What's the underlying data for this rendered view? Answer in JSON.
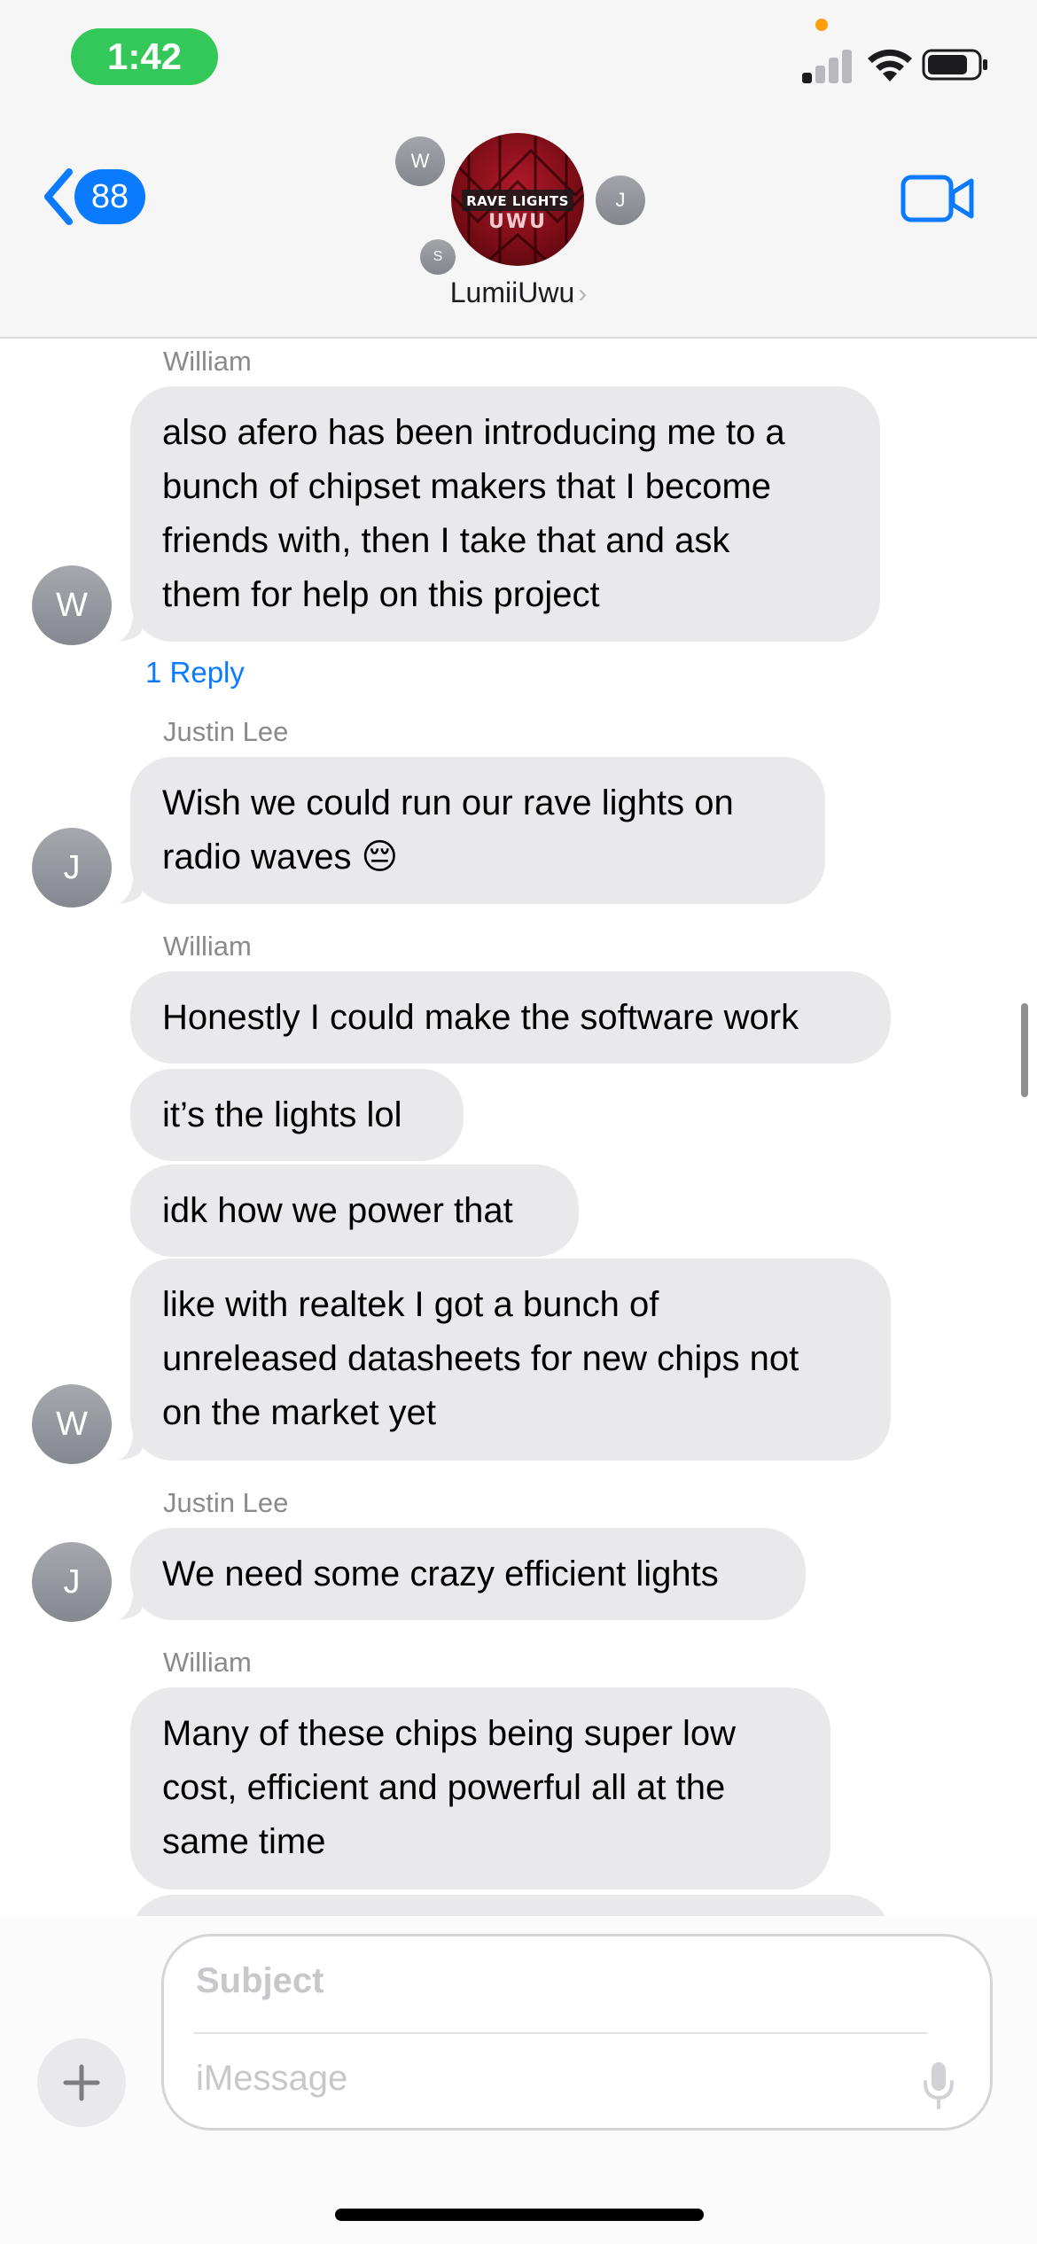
{
  "status_bar": {
    "time": "1:42"
  },
  "header": {
    "back_count": "88",
    "group_name": "LumiiUwu",
    "group_avatar_text_top": "RAVE LIGHTS",
    "group_avatar_text_bottom": "UWU",
    "participant_initials": [
      "W",
      "J",
      "S"
    ]
  },
  "messages": [
    {
      "sender": "William",
      "text": "also afero has been introducing me to a\nbunch of chipset makers that I become\nfriends with, then I take that and ask\nthem for help on this project",
      "avatar": "W"
    },
    {
      "reply_label": "1 Reply"
    },
    {
      "sender": "Justin Lee",
      "text": "Wish we could run our rave lights on\nradio waves 😔",
      "avatar": "J"
    },
    {
      "sender": "William",
      "text": "Honestly I could make the software work"
    },
    {
      "text": "it’s the lights lol"
    },
    {
      "text": "idk how we power that"
    },
    {
      "text": "like with realtek I got a bunch of\nunreleased datasheets for new chips not\non the market yet",
      "avatar": "W"
    },
    {
      "sender": "Justin Lee",
      "text": "We need some crazy efficient lights",
      "avatar": "J"
    },
    {
      "sender": "William",
      "text": "Many of these chips being super low\ncost, efficient and powerful all at the\nsame time"
    }
  ],
  "composer": {
    "subject_placeholder": "Subject",
    "message_placeholder": "iMessage"
  },
  "colors": {
    "accent": "#0a7aff",
    "bubble": "#e9e9eb",
    "time_pill": "#34c759"
  }
}
